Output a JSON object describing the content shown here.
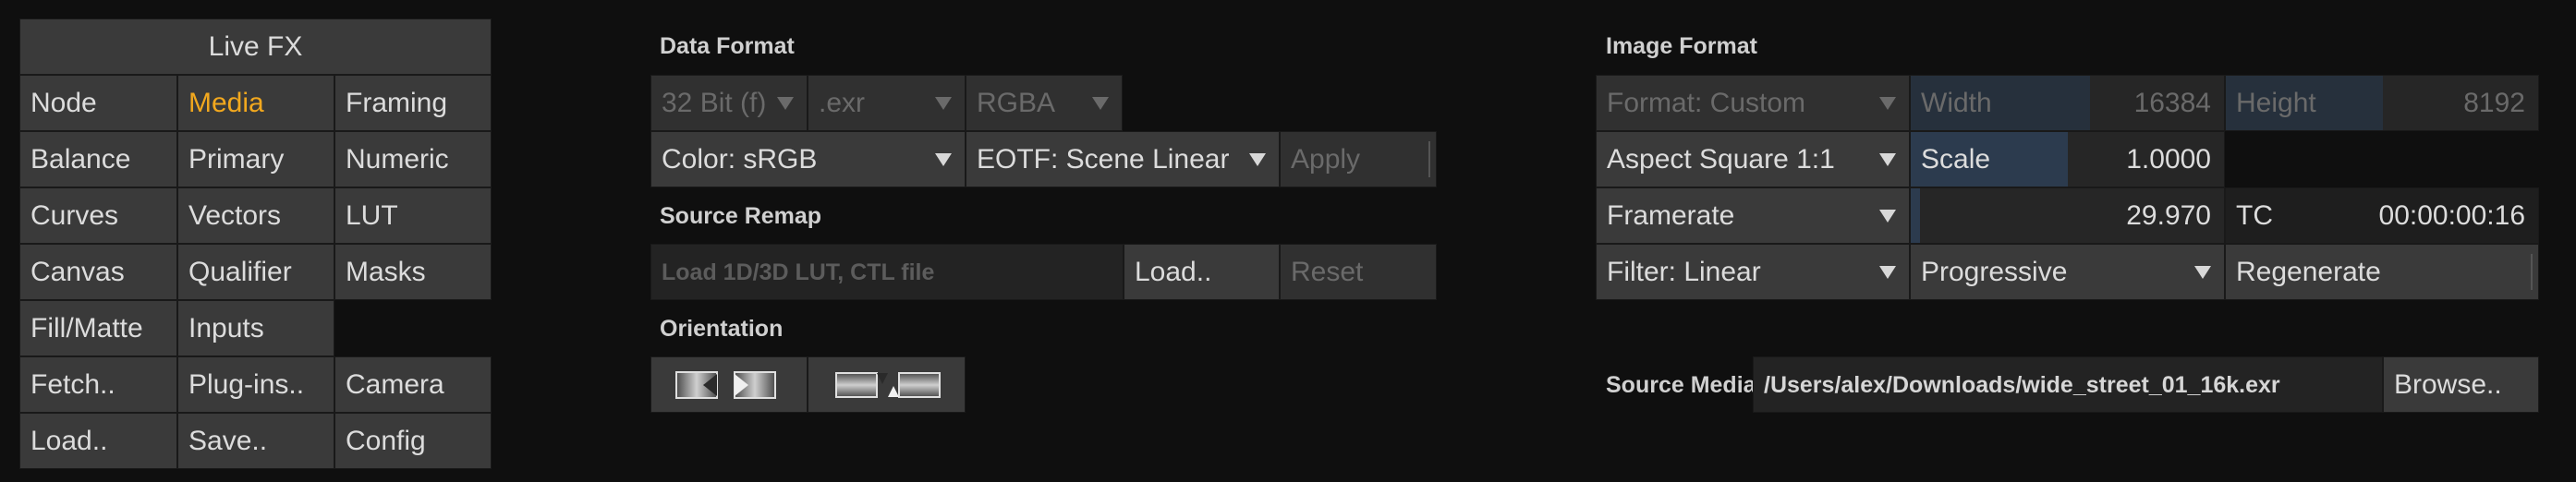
{
  "livefx_panel": {
    "title": "Live FX",
    "buttons": [
      [
        "Node",
        "Media",
        "Framing"
      ],
      [
        "Balance",
        "Primary",
        "Numeric"
      ],
      [
        "Curves",
        "Vectors",
        "LUT"
      ],
      [
        "Canvas",
        "Qualifier",
        "Masks"
      ],
      [
        "Fill/Matte",
        "Inputs",
        ""
      ],
      [
        "Fetch..",
        "Plug-ins..",
        "Camera"
      ],
      [
        "Load..",
        "Save..",
        "Config"
      ]
    ],
    "active": "Media"
  },
  "data_format": {
    "heading": "Data Format",
    "bit_depth": "32 Bit (f)",
    "extension": ".exr",
    "channels": "RGBA",
    "color": "Color: sRGB",
    "eotf": "EOTF: Scene Linear",
    "apply": "Apply"
  },
  "source_remap": {
    "heading": "Source Remap",
    "placeholder": "Load 1D/3D LUT, CTL file",
    "load": "Load..",
    "reset": "Reset"
  },
  "orientation": {
    "heading": "Orientation",
    "flip_horizontal_icon": "flip-horizontal-icon",
    "flip_vertical_icon": "flip-vertical-icon"
  },
  "image_format": {
    "heading": "Image Format",
    "format": "Format: Custom",
    "width_label": "Width",
    "width_value": "16384",
    "height_label": "Height",
    "height_value": "8192",
    "aspect": "Aspect Square 1:1",
    "scale_label": "Scale",
    "scale_value": "1.0000",
    "framerate_label": "Framerate",
    "framerate_value": "29.970",
    "tc_label": "TC",
    "tc_value": "00:00:00:16",
    "filter": "Filter: Linear",
    "scan": "Progressive",
    "regenerate": "Regenerate"
  },
  "source_media": {
    "label": "Source Media",
    "path": "/Users/alex/Downloads/wide_street_01_16k.exr",
    "browse": "Browse.."
  },
  "colors": {
    "accent": "#f2a81e",
    "cell": "#3a3a3a",
    "background": "#0f0f0f",
    "slider_fill": "#2c3b4e"
  }
}
